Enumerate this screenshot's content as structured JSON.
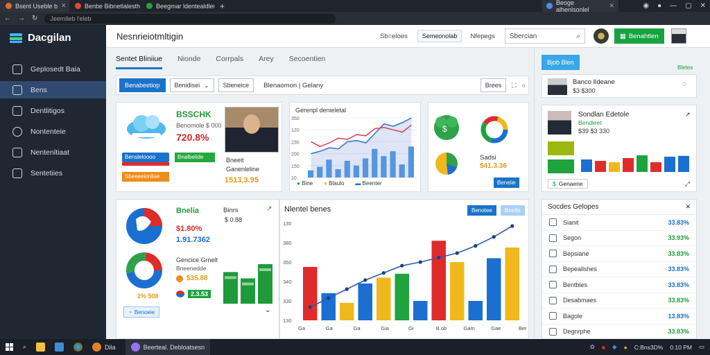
{
  "browser": {
    "tabs": [
      {
        "label": "Bsent Useble b",
        "color": "#e36b2c"
      },
      {
        "label": "Benbe Bibnetlalesth",
        "color": "#e04a2e"
      },
      {
        "label": "Beegmar ldentealdleu",
        "color": "#1fa347"
      }
    ],
    "right_tab": "Beoge alhenlsonlel",
    "url": "Jeemlleb l'eleb"
  },
  "sidebar": {
    "brand": "Dacgilan",
    "items": [
      {
        "label": "Geplosedt Baia",
        "active": false
      },
      {
        "label": "Bens",
        "active": true
      },
      {
        "label": "Dentlitigos",
        "active": false
      },
      {
        "label": "Nontenteie",
        "active": false
      },
      {
        "label": "Nentenltiaat",
        "active": false
      },
      {
        "label": "Sentetiies",
        "active": false
      }
    ]
  },
  "header": {
    "title": "Nesnrieiotmltigin",
    "link1": "Sb=eloes",
    "button1": "Semeonolab",
    "link2": "Nfepegs",
    "search_value": "Sbercian",
    "green_button": "Benahtlen"
  },
  "tabs": [
    {
      "label": "Sentet Bliniiue",
      "active": true
    },
    {
      "label": "Nionde",
      "active": false
    },
    {
      "label": "Corrpals",
      "active": false
    },
    {
      "label": "Arey",
      "active": false
    },
    {
      "label": "Secoentien",
      "active": false
    }
  ],
  "toolbar": {
    "primary": "Benabeetiop",
    "select": "Benidisei",
    "outline": "Sbeneice",
    "crumb_a": "Blenaomon",
    "crumb_b": "Gelany",
    "filter": "Brees"
  },
  "card1": {
    "title": "BSSCHK",
    "subtitle": "Benomole $ 000",
    "value": "720.8%",
    "pill_blue": "Bensleloooo",
    "pill_green": "Bnalbeiide",
    "pill_orange": "Sbeeeeionlise",
    "side_a": "Bneeit",
    "side_b": "Ganenleline",
    "number": "1513,3.95"
  },
  "card2": {
    "title": "Gerenpl denieletal",
    "yticks": [
      "350",
      "120",
      "230",
      "200",
      "150",
      "10"
    ],
    "legend": [
      "Bine",
      "Blaulo",
      "Beenter"
    ],
    "line_red": [
      60,
      52,
      58,
      66,
      64,
      72,
      70,
      82,
      84,
      80,
      76,
      88
    ],
    "line_blue": [
      40,
      44,
      50,
      48,
      60,
      62,
      58,
      74,
      90,
      86,
      92,
      100
    ],
    "bars": [
      12,
      18,
      30,
      14,
      28,
      20,
      32,
      48,
      36,
      44,
      22,
      52
    ]
  },
  "card3": {
    "sub": "Sadsi",
    "value": "$41.3.36",
    "button": "Beneiie"
  },
  "card4": {
    "title": "Bnelia",
    "title2": "Binrs",
    "line1": "$ 0.88",
    "value_red": "$1.80%",
    "value_blue": "1.91.7362",
    "sub": "Gencice Grnelt",
    "sub2": "Bneenedde",
    "amt_orange": "$35.88",
    "amt_blue": "2.3.53",
    "small": "2% 508",
    "chip": "Benoeie"
  },
  "card5": {
    "title": "Nlentel benes",
    "button1": "Benotee",
    "button2": "Bnetle",
    "yticks": [
      "130",
      "380",
      "350",
      "340",
      "330",
      "130"
    ],
    "xticks": [
      "Ga",
      "Ga",
      "Ga",
      "Gia",
      "Gi",
      "B.ob",
      "Gam",
      "Gae",
      "Benioe"
    ],
    "bars": [
      {
        "v": 55,
        "c": "#e02b2b"
      },
      {
        "v": 28,
        "c": "#1a6fd1"
      },
      {
        "v": 18,
        "c": "#f0b81c"
      },
      {
        "v": 38,
        "c": "#1a6fd1"
      },
      {
        "v": 44,
        "c": "#f0b81c"
      },
      {
        "v": 48,
        "c": "#1ea33d"
      },
      {
        "v": 20,
        "c": "#1a6fd1"
      },
      {
        "v": 82,
        "c": "#e02b2b"
      },
      {
        "v": 60,
        "c": "#f0b81c"
      },
      {
        "v": 20,
        "c": "#1a6fd1"
      },
      {
        "v": 64,
        "c": "#1a6fd1"
      },
      {
        "v": 75,
        "c": "#f0b81c"
      }
    ],
    "line": [
      10,
      20,
      30,
      40,
      48,
      56,
      60,
      65,
      70,
      78,
      88,
      100
    ]
  },
  "right": {
    "button": "Bjob Blen",
    "link": "Bletes",
    "person1_title": "Banco lIdeane",
    "person1_value": "$3 $300",
    "person2_title": "Sondlan Edetole",
    "person2_sub": "Bendleet",
    "person2_value": "$39 $3 330",
    "chart_btn": "Genaene",
    "bars": [
      {
        "v": 45,
        "c": "#1a6fd1"
      },
      {
        "v": 40,
        "c": "#e02b2b"
      },
      {
        "v": 35,
        "c": "#f0b81c"
      },
      {
        "v": 50,
        "c": "#e02b2b"
      },
      {
        "v": 60,
        "c": "#1ea33d"
      },
      {
        "v": 35,
        "c": "#e02b2b"
      },
      {
        "v": 55,
        "c": "#1a6fd1"
      },
      {
        "v": 58,
        "c": "#1a6fd1"
      }
    ],
    "list_title": "Socdes Gelopes",
    "list": [
      {
        "label": "Sianit",
        "value": "33.83%",
        "color": "#1a6fc2"
      },
      {
        "label": "Segon",
        "value": "33.93%",
        "color": "#1e9a3a"
      },
      {
        "label": "Bepsiane",
        "value": "33.83%",
        "color": "#1e9a3a"
      },
      {
        "label": "Bepeallshes",
        "value": "33.83%",
        "color": "#1a6fc2"
      },
      {
        "label": "Bentbles",
        "value": "33.83%",
        "color": "#1a6fc2"
      },
      {
        "label": "Desabmaes",
        "value": "33.83%",
        "color": "#1e9a3a"
      },
      {
        "label": "Bagole",
        "value": "13.83%",
        "color": "#1a6fc2"
      },
      {
        "label": "Degnrphe",
        "value": "33.83%",
        "color": "#1e9a3a"
      }
    ]
  },
  "taskbar": {
    "app_label": "Dila",
    "window_label": "Beerteal. Debloatsesn",
    "tray": "C:Bns3D%",
    "clock": "0.10 PM"
  }
}
